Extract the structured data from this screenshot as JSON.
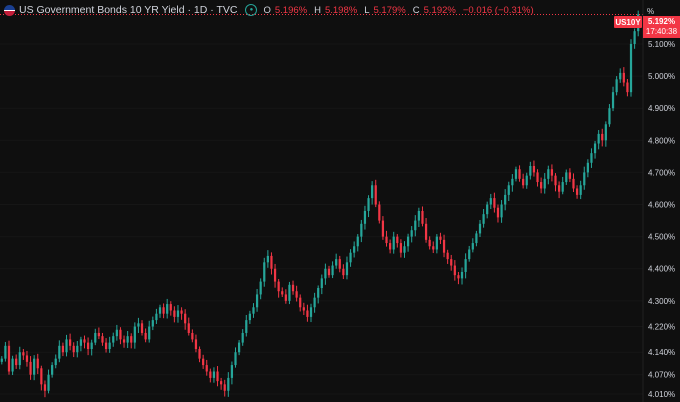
{
  "legend": {
    "title": "US Government Bonds 10 YR Yield · 1D · TVC",
    "flag_icon": "us-flag-icon",
    "status_icon": "market-open-icon",
    "open_label": "O",
    "open_value": "5.196%",
    "high_label": "H",
    "high_value": "5.198%",
    "low_label": "L",
    "low_value": "5.179%",
    "close_label": "C",
    "close_value": "5.192%",
    "change_value": "−0.016 (−0.31%)"
  },
  "price_scale": {
    "unit": "%",
    "symbol_tag": "US10Y",
    "last_price": "5.192%",
    "countdown": "17:40:38"
  },
  "colors": {
    "up": "#26a69a",
    "down": "#f23645",
    "background": "#0f0f0f",
    "text": "#d1d4dc"
  },
  "chart_data": {
    "type": "candlestick",
    "ylim": [
      3.985,
      5.237
    ],
    "y_ticks": [
      "5.100%",
      "5.000%",
      "4.900%",
      "4.800%",
      "4.700%",
      "4.600%",
      "4.500%",
      "4.400%",
      "4.300%",
      "4.220%",
      "4.140%",
      "4.070%",
      "4.010%"
    ],
    "closes": [
      4.12,
      4.16,
      4.08,
      4.12,
      4.1,
      4.14,
      4.13,
      4.11,
      4.07,
      4.12,
      4.09,
      4.04,
      4.02,
      4.07,
      4.1,
      4.12,
      4.16,
      4.14,
      4.18,
      4.16,
      4.14,
      4.16,
      4.18,
      4.17,
      4.15,
      4.17,
      4.2,
      4.19,
      4.17,
      4.15,
      4.17,
      4.19,
      4.21,
      4.18,
      4.17,
      4.19,
      4.17,
      4.22,
      4.23,
      4.2,
      4.18,
      4.22,
      4.24,
      4.26,
      4.28,
      4.26,
      4.29,
      4.27,
      4.25,
      4.27,
      4.26,
      4.23,
      4.2,
      4.18,
      4.15,
      4.12,
      4.1,
      4.08,
      4.06,
      4.08,
      4.05,
      4.04,
      4.02,
      4.06,
      4.1,
      4.14,
      4.17,
      4.2,
      4.24,
      4.26,
      4.28,
      4.32,
      4.36,
      4.42,
      4.44,
      4.4,
      4.36,
      4.33,
      4.32,
      4.3,
      4.35,
      4.33,
      4.31,
      4.28,
      4.27,
      4.25,
      4.28,
      4.31,
      4.34,
      4.37,
      4.4,
      4.38,
      4.41,
      4.43,
      4.4,
      4.38,
      4.42,
      4.45,
      4.47,
      4.5,
      4.54,
      4.58,
      4.62,
      4.66,
      4.6,
      4.55,
      4.5,
      4.48,
      4.46,
      4.5,
      4.48,
      4.45,
      4.47,
      4.5,
      4.52,
      4.55,
      4.58,
      4.54,
      4.49,
      4.47,
      4.46,
      4.5,
      4.49,
      4.45,
      4.43,
      4.41,
      4.38,
      4.37,
      4.39,
      4.43,
      4.46,
      4.48,
      4.51,
      4.54,
      4.57,
      4.6,
      4.62,
      4.59,
      4.56,
      4.6,
      4.63,
      4.66,
      4.68,
      4.71,
      4.68,
      4.66,
      4.69,
      4.72,
      4.7,
      4.67,
      4.65,
      4.68,
      4.71,
      4.69,
      4.66,
      4.64,
      4.67,
      4.7,
      4.68,
      4.65,
      4.63,
      4.66,
      4.7,
      4.73,
      4.76,
      4.79,
      4.82,
      4.8,
      4.85,
      4.9,
      4.95,
      4.99,
      5.01,
      4.98,
      4.95,
      5.1,
      5.14,
      5.192
    ]
  }
}
